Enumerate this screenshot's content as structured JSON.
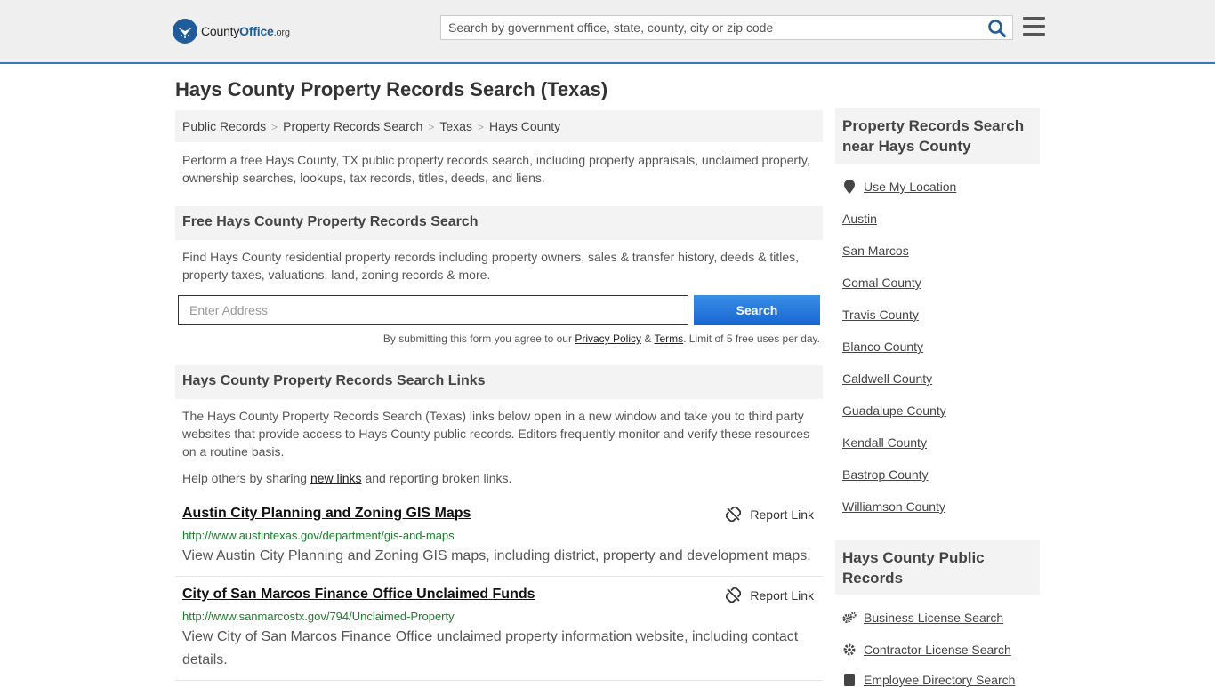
{
  "header": {
    "logo_county": "County",
    "logo_office": "Office",
    "logo_org": ".org",
    "search_placeholder": "Search by government office, state, county, city or zip code"
  },
  "page": {
    "title": "Hays County Property Records Search (Texas)",
    "breadcrumb": [
      "Public Records",
      "Property Records Search",
      "Texas",
      "Hays County"
    ],
    "intro": "Perform a free Hays County, TX public property records search, including property appraisals, unclaimed property, ownership searches, lookups, tax records, titles, deeds, and liens."
  },
  "free_search": {
    "heading": "Free Hays County Property Records Search",
    "description": "Find Hays County residential property records including property owners, sales & transfer history, deeds & titles, property taxes, valuations, land, zoning records & more.",
    "input_placeholder": "Enter Address",
    "button_label": "Search",
    "terms_prefix": "By submitting this form you agree to our ",
    "privacy_label": "Privacy Policy",
    "terms_amp": " & ",
    "terms_label": "Terms",
    "terms_suffix": ". Limit of 5 free uses per day."
  },
  "links_section": {
    "heading": "Hays County Property Records Search Links",
    "description": "The Hays County Property Records Search (Texas) links below open in a new window and take you to third party websites that provide access to Hays County public records. Editors frequently monitor and verify these resources on a routine basis.",
    "help_prefix": "Help others by sharing ",
    "help_link": "new links",
    "help_suffix": " and reporting broken links.",
    "report_label": "Report Link",
    "results": [
      {
        "title": "Austin City Planning and Zoning GIS Maps",
        "url": "http://www.austintexas.gov/department/gis-and-maps",
        "description": "View Austin City Planning and Zoning GIS maps, including district, property and development maps."
      },
      {
        "title": "City of San Marcos Finance Office Unclaimed Funds",
        "url": "http://www.sanmarcostx.gov/794/Unclaimed-Property",
        "description": "View City of San Marcos Finance Office unclaimed property information website, including contact details."
      }
    ]
  },
  "sidebar": {
    "nearby_heading": "Property Records Search near Hays County",
    "use_location": "Use My Location",
    "nearby": [
      "Austin",
      "San Marcos",
      "Comal County",
      "Travis County",
      "Blanco County",
      "Caldwell County",
      "Guadalupe County",
      "Kendall County",
      "Bastrop County",
      "Williamson County"
    ],
    "public_heading": "Hays County Public Records",
    "public_links": [
      "Business License Search",
      "Contractor License Search",
      "Employee Directory Search"
    ]
  },
  "colors": {
    "accent": "#3a76b8",
    "button": "#1f6fd9",
    "url_green": "#1a7d2b"
  }
}
